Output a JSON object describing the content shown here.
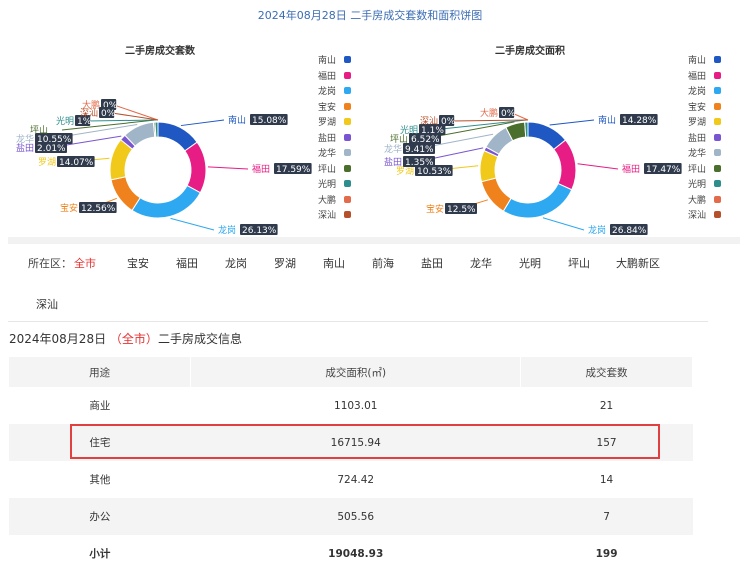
{
  "page_title": "2024年08月28日 二手房成交套数和面积饼图",
  "chart_data": [
    {
      "type": "pie",
      "title": "二手房成交套数",
      "categories": [
        "南山",
        "福田",
        "龙岗",
        "宝安",
        "罗湖",
        "盐田",
        "龙华",
        "坪山",
        "光明",
        "大鹏",
        "深汕"
      ],
      "values": [
        15.08,
        17.59,
        26.13,
        12.56,
        14.07,
        2.01,
        10.55,
        0.5,
        1.01,
        0,
        0
      ],
      "labels": [
        "15.08%",
        "17.59%",
        "26.13%",
        "12.56%",
        "14.07%",
        "2.01%",
        "10.55%",
        "",
        "1%",
        "0%",
        "0%"
      ],
      "legend_position": "right"
    },
    {
      "type": "pie",
      "title": "二手房成交面积",
      "categories": [
        "南山",
        "福田",
        "龙岗",
        "宝安",
        "罗湖",
        "盐田",
        "龙华",
        "坪山",
        "光明",
        "大鹏",
        "深汕"
      ],
      "values": [
        14.28,
        17.47,
        26.84,
        12.5,
        10.53,
        1.35,
        9.41,
        6.52,
        1.1,
        0,
        0
      ],
      "labels": [
        "14.28%",
        "17.47%",
        "26.84%",
        "12.5%",
        "10.53%",
        "1.35%",
        "9.41%",
        "6.52%",
        "1.1%",
        "0%",
        "0%"
      ],
      "legend_position": "right"
    }
  ],
  "legend_colors": [
    "#1f57c3",
    "#e81c85",
    "#2ea8f0",
    "#f0821d",
    "#f0c91a",
    "#7a55d2",
    "#a0b5c8",
    "#4a6e2b",
    "#2e8e8e",
    "#e36a4a",
    "#b6502a"
  ],
  "filter": {
    "label": "所在区：",
    "districts": [
      "全市",
      "宝安",
      "福田",
      "龙岗",
      "罗湖",
      "南山",
      "前海",
      "盐田",
      "龙华",
      "光明",
      "坪山",
      "大鹏新区",
      "深汕"
    ],
    "active": "全市"
  },
  "section": {
    "date": "2024年08月28日",
    "region": "（全市）",
    "suffix": "二手房成交信息"
  },
  "table": {
    "headers": [
      "用途",
      "成交面积(㎡)",
      "成交套数"
    ],
    "rows": [
      [
        "商业",
        "1103.01",
        "21"
      ],
      [
        "住宅",
        "16715.94",
        "157"
      ],
      [
        "其他",
        "724.42",
        "14"
      ],
      [
        "办公",
        "505.56",
        "7"
      ],
      [
        "小计",
        "19048.93",
        "199"
      ]
    ]
  }
}
